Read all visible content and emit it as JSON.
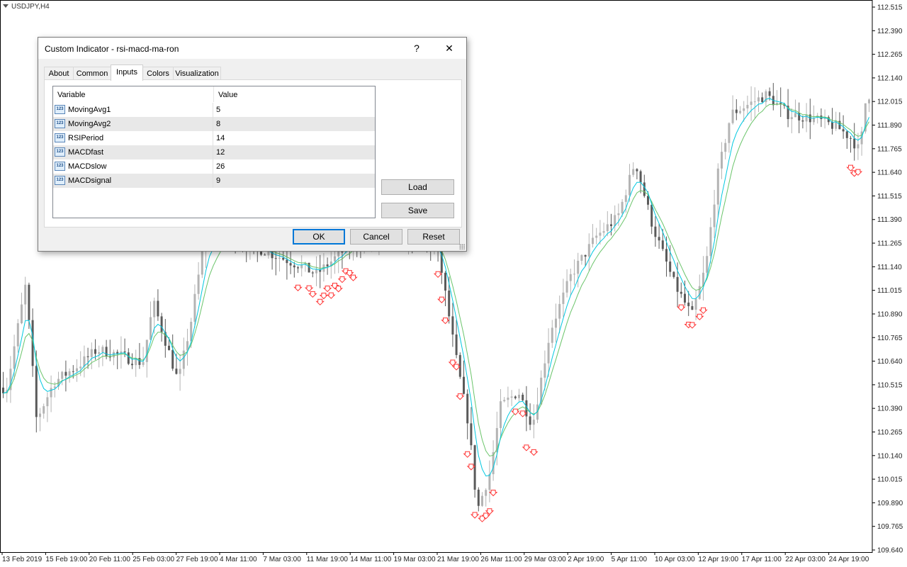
{
  "chart": {
    "symbol": "USDJPY,H4",
    "price_levels": [
      "112.515",
      "112.390",
      "112.265",
      "112.140",
      "112.015",
      "111.890",
      "111.765",
      "111.640",
      "111.515",
      "111.390",
      "111.265",
      "111.140",
      "111.015",
      "110.890",
      "110.765",
      "110.640",
      "110.515",
      "110.390",
      "110.265",
      "110.140",
      "110.015",
      "109.890",
      "109.765",
      "109.640"
    ],
    "time_labels": [
      "13 Feb 2019",
      "15 Feb 19:00",
      "20 Feb 11:00",
      "25 Feb 03:00",
      "27 Feb 19:00",
      "4 Mar 11:00",
      "7 Mar 03:00",
      "11 Mar 19:00",
      "14 Mar 11:00",
      "19 Mar 03:00",
      "21 Mar 19:00",
      "26 Mar 11:00",
      "29 Mar 03:00",
      "2 Apr 19:00",
      "5 Apr 11:00",
      "10 Apr 03:00",
      "12 Apr 19:00",
      "17 Apr 11:00",
      "22 Apr 03:00",
      "24 Apr 19:00"
    ],
    "colors": {
      "ma_fast": "#00c8e0",
      "ma_slow": "#6ac46a",
      "arrow": "#ff3333",
      "bull": "#b4b4b4",
      "bear": "#5a5a5a"
    }
  },
  "chart_data": {
    "type": "candlestick",
    "title": "USDJPY,H4",
    "ylim": [
      109.62,
      112.55
    ],
    "anchors": [
      [
        "13 Feb 2019",
        110.52
      ],
      [
        "15 Feb 19:00",
        110.46
      ],
      [
        "20 Feb 11:00",
        110.74
      ],
      [
        "25 Feb 03:00",
        110.62
      ],
      [
        "27 Feb 19:00",
        111.34
      ],
      [
        "4 Mar 11:00",
        111.32
      ],
      [
        "7 Mar 03:00",
        111.16
      ],
      [
        "11 Mar 19:00",
        111.14
      ],
      [
        "14 Mar 11:00",
        111.3
      ],
      [
        "19 Mar 03:00",
        111.36
      ],
      [
        "21 Mar 19:00",
        110.58
      ],
      [
        "26 Mar 11:00",
        110.3
      ],
      [
        "29 Mar 03:00",
        110.88
      ],
      [
        "2 Apr 19:00",
        111.38
      ],
      [
        "5 Apr 11:00",
        111.46
      ],
      [
        "10 Apr 03:00",
        111.06
      ],
      [
        "12 Apr 19:00",
        111.96
      ],
      [
        "17 Apr 11:00",
        111.96
      ],
      [
        "22 Apr 03:00",
        111.92
      ],
      [
        "24 Apr 19:00",
        112.02
      ]
    ],
    "series": [
      {
        "name": "MovingAvg1"
      },
      {
        "name": "MovingAvg2"
      }
    ]
  },
  "dialog": {
    "title": "Custom Indicator - rsi-macd-ma-ron",
    "help": "?",
    "close": "✕",
    "tabs": [
      {
        "label": "About"
      },
      {
        "label": "Common"
      },
      {
        "label": "Inputs"
      },
      {
        "label": "Colors"
      },
      {
        "label": "Visualization"
      }
    ],
    "active_tab": "Inputs",
    "table": {
      "headers": [
        "Variable",
        "Value"
      ],
      "icon_text": "123",
      "rows": [
        {
          "variable": "MovingAvg1",
          "value": "5"
        },
        {
          "variable": "MovingAvg2",
          "value": "8"
        },
        {
          "variable": "RSIPeriod",
          "value": "14"
        },
        {
          "variable": "MACDfast",
          "value": "12"
        },
        {
          "variable": "MACDslow",
          "value": "26"
        },
        {
          "variable": "MACDsignal",
          "value": "9"
        }
      ]
    },
    "buttons": {
      "load": "Load",
      "save": "Save",
      "ok": "OK",
      "cancel": "Cancel",
      "reset": "Reset"
    }
  }
}
